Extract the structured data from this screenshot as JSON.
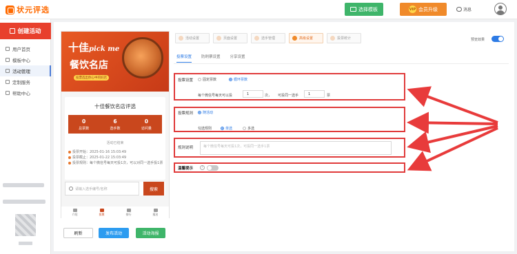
{
  "app": {
    "logo_text": "状元评选"
  },
  "topbar": {
    "select_template": "选择模板",
    "vip_badge": "VIP",
    "vip_upgrade": "会员升级",
    "messages": "消息"
  },
  "sidebar": {
    "create": "创建活动",
    "items": [
      {
        "label": "用户首页"
      },
      {
        "label": "模板中心"
      },
      {
        "label": "活动管理"
      },
      {
        "label": "定制服务"
      },
      {
        "label": "帮助中心"
      }
    ]
  },
  "preview": {
    "banner_line1_big": "十佳",
    "banner_line1_small": "pick me",
    "banner_line2": "餐饮名店",
    "banner_tag": "投票选出你心中的好店",
    "title": "十佳餐饮名店评选",
    "stats": [
      {
        "value": "0",
        "label": "总票数"
      },
      {
        "value": "6",
        "label": "选手数"
      },
      {
        "value": "0",
        "label": "访问量"
      }
    ],
    "ended": "活动已结束",
    "info": [
      "投票开始：2025-01-16 15:03:49",
      "投票截止：2025-01-22 15:03:49",
      "投票规则：每个微信号每天可投1次，可以对同一选手投1票"
    ],
    "search_placeholder": "请输入选手编号/名称",
    "search_button": "搜索",
    "tabbar": [
      "介绍",
      "投票",
      "排行",
      "报名"
    ]
  },
  "footer_buttons": {
    "refresh": "刷新",
    "publish": "发布活动",
    "poster": "活动海报"
  },
  "steps": [
    "活动设置",
    "页面设置",
    "选手管理",
    "高级设置",
    "投票统计"
  ],
  "preview_toggle_label": "预览效果",
  "subtabs": [
    "投票设置",
    "防刷票设置",
    "分享设置"
  ],
  "vote_settings": {
    "vote_setting_label": "投票设置",
    "fixed_votes": "固定票数",
    "loop_votes": "循环票数",
    "per_day_prefix": "每个微信号每天可以投",
    "per_day_value": "1",
    "times_unit": "次，",
    "same_player_prefix": "可投同一选手",
    "same_player_value": "1",
    "votes_unit": "票",
    "rule_label": "投票规则",
    "rule_option": "随活动",
    "check_rule_label": "勾选规则",
    "single": "单选",
    "multi": "多选",
    "rule_desc_label": "规则说明",
    "rule_desc_placeholder": "每个微信号每天可投1次，可投同一选手1票",
    "reminder_label": "温馨提示",
    "help_glyph": "?"
  }
}
